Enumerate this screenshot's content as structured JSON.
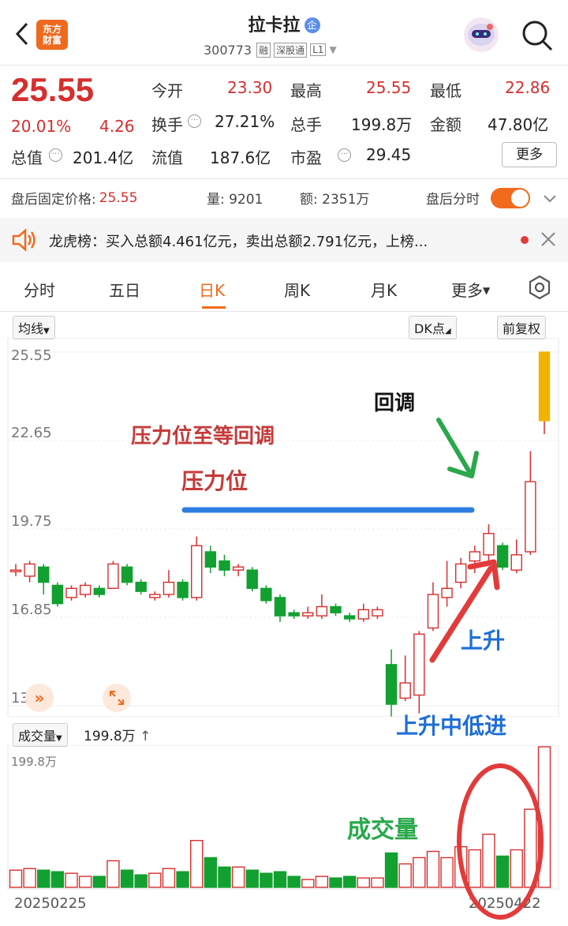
{
  "header": {
    "app_logo_line1": "东方",
    "app_logo_line2": "财富",
    "stock_name": "拉卡拉",
    "badge": "企",
    "code": "300773",
    "tags": [
      "融",
      "深股通",
      "L1"
    ]
  },
  "quote": {
    "price": "25.55",
    "change_pct": "20.01%",
    "change_amt": "4.26",
    "rows": [
      [
        {
          "k": "今开",
          "v": "23.30",
          "c": "red"
        },
        {
          "k": "最高",
          "v": "25.55",
          "c": "red"
        },
        {
          "k": "最低",
          "v": "22.86",
          "c": "red"
        }
      ],
      [
        {
          "k": "换手",
          "v": "27.21%",
          "c": "dark"
        },
        {
          "k": "总手",
          "v": "199.8万",
          "c": "dark"
        },
        {
          "k": "金额",
          "v": "47.80亿",
          "c": "dark"
        }
      ],
      [
        {
          "k": "总值",
          "v": "201.4亿",
          "c": "dark"
        },
        {
          "k": "流值",
          "v": "187.6亿",
          "c": "dark"
        },
        {
          "k": "市盈",
          "v": "29.45",
          "c": "dark"
        }
      ]
    ],
    "more_label": "更多"
  },
  "after_hours": {
    "price_label": "盘后固定价格:",
    "price": "25.55",
    "vol_label": "量:",
    "vol": "9201",
    "amt_label": "额:",
    "amt": "2351万",
    "toggle_label": "盘后分时"
  },
  "notice": {
    "text": "龙虎榜：买入总额4.461亿元，卖出总额2.791亿元，上榜..."
  },
  "tabs": [
    "分时",
    "五日",
    "日K",
    "周K",
    "月K",
    "更多"
  ],
  "active_tab": "日K",
  "chart_controls": {
    "ma": "均线",
    "dk": "DK点",
    "adjust": "前复权"
  },
  "volume_controls": {
    "label": "成交量",
    "value": "199.8万",
    "axis_max": "199.8万"
  },
  "annotations": {
    "resistance_retrace": "压力位至等回调",
    "resistance": "压力位",
    "pullback": "回调",
    "rise": "上升",
    "rise_low_entry": "上升中低进",
    "volume": "成交量"
  },
  "dates": {
    "start": "20250225",
    "end": "20250422"
  },
  "chart_data": {
    "type": "candlestick",
    "y_ticks": [
      "25.55",
      "22.65",
      "19.75",
      "16.85",
      "13.95"
    ],
    "ylim": [
      13.95,
      25.55
    ],
    "candles": [
      {
        "o": 18.4,
        "c": 18.4,
        "h": 18.6,
        "l": 18.2,
        "v": 22
      },
      {
        "o": 18.2,
        "c": 18.6,
        "h": 18.7,
        "l": 18.0,
        "v": 24
      },
      {
        "o": 18.5,
        "c": 18.0,
        "h": 18.6,
        "l": 17.6,
        "v": 22
      },
      {
        "o": 17.9,
        "c": 17.3,
        "h": 18.0,
        "l": 17.2,
        "v": 20
      },
      {
        "o": 17.5,
        "c": 17.8,
        "h": 17.9,
        "l": 17.4,
        "v": 18
      },
      {
        "o": 17.6,
        "c": 17.9,
        "h": 18.0,
        "l": 17.5,
        "v": 14
      },
      {
        "o": 17.8,
        "c": 17.6,
        "h": 17.9,
        "l": 17.5,
        "v": 14
      },
      {
        "o": 17.8,
        "c": 18.6,
        "h": 18.7,
        "l": 17.8,
        "v": 34
      },
      {
        "o": 18.5,
        "c": 18.0,
        "h": 18.6,
        "l": 17.9,
        "v": 22
      },
      {
        "o": 18.0,
        "c": 17.7,
        "h": 18.1,
        "l": 17.6,
        "v": 16
      },
      {
        "o": 17.5,
        "c": 17.6,
        "h": 17.7,
        "l": 17.4,
        "v": 18
      },
      {
        "o": 17.6,
        "c": 18.0,
        "h": 18.4,
        "l": 17.5,
        "v": 24
      },
      {
        "o": 18.0,
        "c": 17.5,
        "h": 18.1,
        "l": 17.4,
        "v": 20
      },
      {
        "o": 17.5,
        "c": 19.2,
        "h": 19.5,
        "l": 17.4,
        "v": 60
      },
      {
        "o": 19.0,
        "c": 18.5,
        "h": 19.2,
        "l": 18.3,
        "v": 38
      },
      {
        "o": 18.7,
        "c": 18.4,
        "h": 18.9,
        "l": 18.2,
        "v": 26
      },
      {
        "o": 18.4,
        "c": 18.5,
        "h": 18.6,
        "l": 18.2,
        "v": 26
      },
      {
        "o": 18.4,
        "c": 17.8,
        "h": 18.5,
        "l": 17.7,
        "v": 22
      },
      {
        "o": 17.8,
        "c": 17.4,
        "h": 17.9,
        "l": 17.3,
        "v": 18
      },
      {
        "o": 17.5,
        "c": 16.9,
        "h": 17.6,
        "l": 16.7,
        "v": 20
      },
      {
        "o": 17.0,
        "c": 16.9,
        "h": 17.1,
        "l": 16.8,
        "v": 14
      },
      {
        "o": 16.9,
        "c": 17.0,
        "h": 17.2,
        "l": 16.8,
        "v": 10
      },
      {
        "o": 16.9,
        "c": 17.2,
        "h": 17.6,
        "l": 16.8,
        "v": 14
      },
      {
        "o": 17.2,
        "c": 17.0,
        "h": 17.3,
        "l": 16.9,
        "v": 12
      },
      {
        "o": 16.9,
        "c": 16.8,
        "h": 17.0,
        "l": 16.7,
        "v": 14
      },
      {
        "o": 16.8,
        "c": 17.1,
        "h": 17.3,
        "l": 16.7,
        "v": 12
      },
      {
        "o": 16.9,
        "c": 17.1,
        "h": 17.2,
        "l": 16.8,
        "v": 12
      },
      {
        "o": 15.3,
        "c": 14.0,
        "h": 15.8,
        "l": 13.6,
        "v": 44
      },
      {
        "o": 14.2,
        "c": 14.7,
        "h": 15.6,
        "l": 14.1,
        "v": 30
      },
      {
        "o": 14.3,
        "c": 16.3,
        "h": 16.4,
        "l": 13.7,
        "v": 38
      },
      {
        "o": 16.5,
        "c": 17.6,
        "h": 18.0,
        "l": 16.4,
        "v": 46
      },
      {
        "o": 17.5,
        "c": 17.8,
        "h": 18.7,
        "l": 17.2,
        "v": 38
      },
      {
        "o": 18.0,
        "c": 18.6,
        "h": 18.8,
        "l": 17.8,
        "v": 52
      },
      {
        "o": 18.7,
        "c": 19.0,
        "h": 19.2,
        "l": 18.3,
        "v": 48
      },
      {
        "o": 18.9,
        "c": 19.6,
        "h": 19.9,
        "l": 18.6,
        "v": 68
      },
      {
        "o": 19.2,
        "c": 18.5,
        "h": 19.3,
        "l": 18.4,
        "v": 40
      },
      {
        "o": 18.4,
        "c": 18.9,
        "h": 19.4,
        "l": 18.3,
        "v": 48
      },
      {
        "o": 19.0,
        "c": 21.3,
        "h": 22.3,
        "l": 18.9,
        "v": 100
      },
      {
        "o": 23.3,
        "c": 25.55,
        "h": 25.55,
        "l": 22.86,
        "v": 180
      }
    ]
  }
}
